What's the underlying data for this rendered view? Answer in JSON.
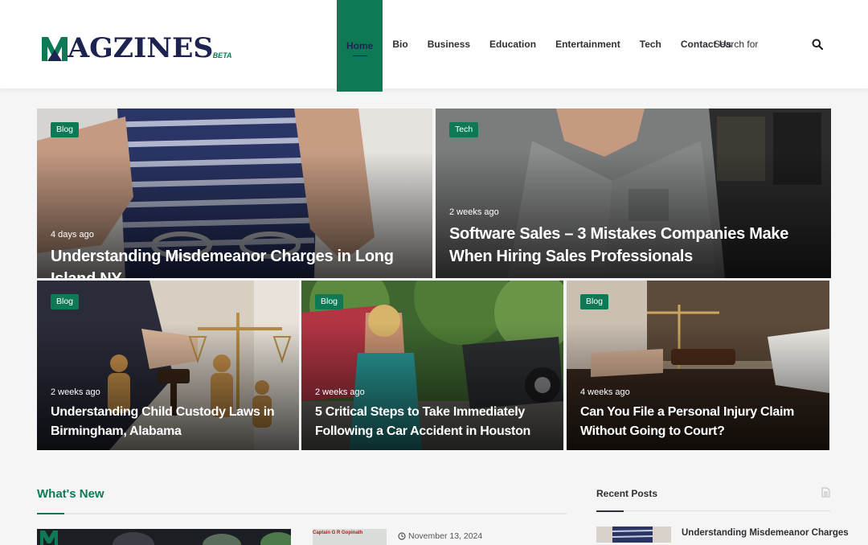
{
  "brand": {
    "name": "AGZINES",
    "beta": "BETA",
    "primary_color": "#0d7a55",
    "dark_color": "#1c2350"
  },
  "nav": {
    "items": [
      {
        "label": "Home",
        "active": true
      },
      {
        "label": "Bio"
      },
      {
        "label": "Business"
      },
      {
        "label": "Education"
      },
      {
        "label": "Entertainment"
      },
      {
        "label": "Tech"
      },
      {
        "label": "Contact Us"
      }
    ]
  },
  "search": {
    "placeholder": "Search for",
    "icon": "search-icon"
  },
  "featured": [
    {
      "category": "Blog",
      "time": "4 days ago",
      "title": "Understanding Misdemeanor Charges in Long Island NY"
    },
    {
      "category": "Tech",
      "time": "2 weeks ago",
      "title": "Software Sales – 3 Mistakes Companies Make When Hiring Sales Professionals"
    },
    {
      "category": "Blog",
      "time": "2 weeks ago",
      "title": "Understanding Child Custody Laws in Birmingham, Alabama"
    },
    {
      "category": "Blog",
      "time": "2 weeks ago",
      "title": "5 Critical Steps to Take Immediately Following a Car Accident in Houston"
    },
    {
      "category": "Blog",
      "time": "4 weeks ago",
      "title": "Can You File a Personal Injury Claim Without Going to Court?"
    }
  ],
  "whats_new": {
    "title": "What's New",
    "items": [
      {
        "thumb_caption": ""
      },
      {
        "thumb_caption": "Captain G R Gopinath",
        "date": "November 13, 2024",
        "icon": "clock-icon"
      }
    ]
  },
  "recent_posts": {
    "title": "Recent Posts",
    "icon": "document-icon",
    "items": [
      {
        "title": "Understanding Misdemeanor Charges"
      }
    ]
  }
}
